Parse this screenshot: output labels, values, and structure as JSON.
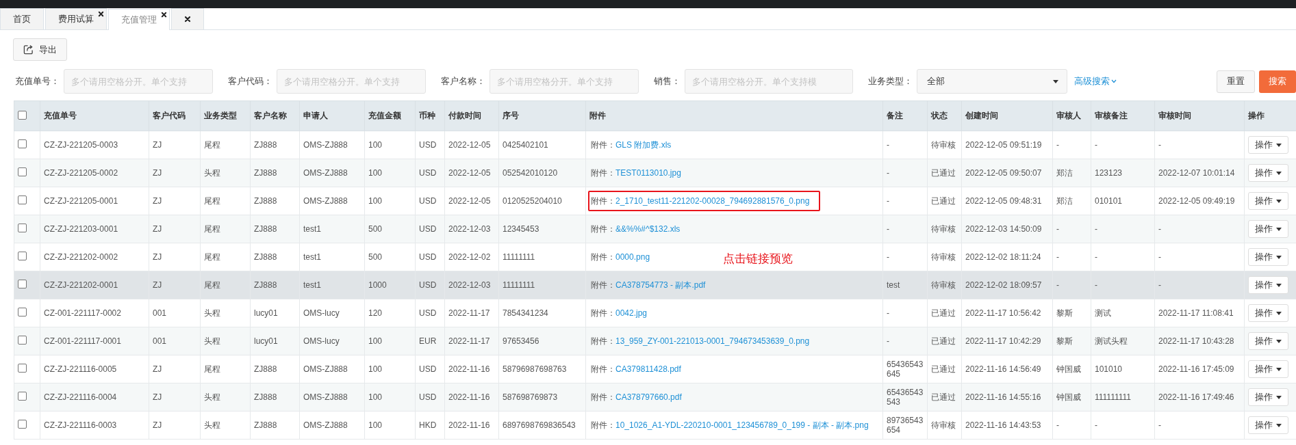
{
  "tabs": [
    {
      "kind": "page",
      "label": "首页",
      "closable": false,
      "selected": false
    },
    {
      "kind": "page",
      "label": "费用试算",
      "closable": true,
      "selected": false
    },
    {
      "kind": "page",
      "label": "充值管理",
      "closable": true,
      "selected": true
    },
    {
      "kind": "close-all",
      "selected": false
    }
  ],
  "toolbar": {
    "export_button": "导出"
  },
  "filters": [
    {
      "kind": "text",
      "label": "充值单号：",
      "placeholder": "多个请用空格分开。单个支持"
    },
    {
      "kind": "text",
      "label": "客户代码：",
      "placeholder": "多个请用空格分开。单个支持"
    },
    {
      "kind": "text",
      "label": "客户名称：",
      "placeholder": "多个请用空格分开。单个支持"
    },
    {
      "kind": "text",
      "label": "销售：",
      "placeholder": "多个请用空格分开。单个支持模"
    },
    {
      "kind": "select",
      "label": "业务类型：",
      "value": "全部"
    }
  ],
  "advanced_search": "高级搜索",
  "buttons": {
    "reset": "重置",
    "search": "搜索"
  },
  "table": {
    "select_all": {
      "checked": false
    },
    "columns": [
      "充值单号",
      "客户代码",
      "业务类型",
      "客户名称",
      "申请人",
      "充值金额",
      "币种",
      "付款时间",
      "序号",
      "附件",
      "备注",
      "状态",
      "创建时间",
      "审核人",
      "审核备注",
      "审核时间",
      "操作"
    ],
    "rows": [
      {
        "checked": false,
        "hovered": false,
        "annotated": false,
        "cells": [
          "CZ-ZJ-221205-0003",
          "ZJ",
          "尾程",
          "ZJ888",
          "OMS-ZJ888",
          "100",
          "USD",
          "2022-12-05",
          "0425402101"
        ],
        "attachment": {
          "label": "附件：",
          "file": "GLS 附加费.xls"
        },
        "tail": [
          "-",
          "待审核",
          "2022-12-05 09:51:19",
          "-",
          "-",
          "-"
        ],
        "action": "操作"
      },
      {
        "checked": false,
        "hovered": false,
        "annotated": false,
        "cells": [
          "CZ-ZJ-221205-0002",
          "ZJ",
          "头程",
          "ZJ888",
          "OMS-ZJ888",
          "100",
          "USD",
          "2022-12-05",
          "052542010120"
        ],
        "attachment": {
          "label": "附件：",
          "file": "TEST0113010.jpg"
        },
        "tail": [
          "-",
          "已通过",
          "2022-12-05 09:50:07",
          "郑洁",
          "123123",
          "2022-12-07 10:01:14"
        ],
        "action": "操作"
      },
      {
        "checked": false,
        "hovered": false,
        "annotated": true,
        "cells": [
          "CZ-ZJ-221205-0001",
          "ZJ",
          "尾程",
          "ZJ888",
          "OMS-ZJ888",
          "100",
          "USD",
          "2022-12-05",
          "0120525204010"
        ],
        "attachment": {
          "label": "附件：",
          "file": "2_1710_test11-221202-00028_794692881576_0.png"
        },
        "tail": [
          "-",
          "已通过",
          "2022-12-05 09:48:31",
          "郑洁",
          "010101",
          "2022-12-05 09:49:19"
        ],
        "action": "操作"
      },
      {
        "checked": false,
        "hovered": false,
        "annotated": false,
        "cells": [
          "CZ-ZJ-221203-0001",
          "ZJ",
          "尾程",
          "ZJ888",
          "test1",
          "500",
          "USD",
          "2022-12-03",
          "12345453"
        ],
        "attachment": {
          "label": "附件：",
          "file": "&&%%#^$132.xls"
        },
        "tail": [
          "-",
          "待审核",
          "2022-12-03 14:50:09",
          "-",
          "-",
          "-"
        ],
        "action": "操作"
      },
      {
        "checked": false,
        "hovered": false,
        "annotated": false,
        "cells": [
          "CZ-ZJ-221202-0002",
          "ZJ",
          "尾程",
          "ZJ888",
          "test1",
          "500",
          "USD",
          "2022-12-02",
          "11111111"
        ],
        "attachment": {
          "label": "附件：",
          "file": "0000.png"
        },
        "tail": [
          "-",
          "待审核",
          "2022-12-02 18:11:24",
          "-",
          "-",
          "-"
        ],
        "action": "操作"
      },
      {
        "checked": false,
        "hovered": true,
        "annotated": false,
        "cells": [
          "CZ-ZJ-221202-0001",
          "ZJ",
          "尾程",
          "ZJ888",
          "test1",
          "1000",
          "USD",
          "2022-12-03",
          "11111111"
        ],
        "attachment": {
          "label": "附件：",
          "file": "CA378754773 - 副本.pdf"
        },
        "tail": [
          "test",
          "待审核",
          "2022-12-02 18:09:57",
          "-",
          "-",
          "-"
        ],
        "action": "操作"
      },
      {
        "checked": false,
        "hovered": false,
        "annotated": false,
        "cells": [
          "CZ-001-221117-0002",
          "001",
          "头程",
          "lucy01",
          "OMS-lucy",
          "120",
          "USD",
          "2022-11-17",
          "7854341234"
        ],
        "attachment": {
          "label": "附件：",
          "file": "0042.jpg"
        },
        "tail": [
          "-",
          "已通过",
          "2022-11-17 10:56:42",
          "黎斯",
          "测试",
          "2022-11-17 11:08:41"
        ],
        "action": "操作"
      },
      {
        "checked": false,
        "hovered": false,
        "annotated": false,
        "cells": [
          "CZ-001-221117-0001",
          "001",
          "头程",
          "lucy01",
          "OMS-lucy",
          "100",
          "EUR",
          "2022-11-17",
          "97653456"
        ],
        "attachment": {
          "label": "附件：",
          "file": "13_959_ZY-001-221013-0001_794673453639_0.png"
        },
        "tail": [
          "-",
          "已通过",
          "2022-11-17 10:42:29",
          "黎斯",
          "测试头程",
          "2022-11-17 10:43:28"
        ],
        "action": "操作"
      },
      {
        "checked": false,
        "hovered": false,
        "annotated": false,
        "cells": [
          "CZ-ZJ-221116-0005",
          "ZJ",
          "尾程",
          "ZJ888",
          "OMS-ZJ888",
          "100",
          "USD",
          "2022-11-16",
          "58796987698763"
        ],
        "attachment": {
          "label": "附件：",
          "file": "CA379811428.pdf"
        },
        "tail": [
          "65436543645",
          "已通过",
          "2022-11-16 14:56:49",
          "钟国威",
          "101010",
          "2022-11-16 17:45:09"
        ],
        "action": "操作"
      },
      {
        "checked": false,
        "hovered": false,
        "annotated": false,
        "cells": [
          "CZ-ZJ-221116-0004",
          "ZJ",
          "头程",
          "ZJ888",
          "OMS-ZJ888",
          "100",
          "USD",
          "2022-11-16",
          "587698769873"
        ],
        "attachment": {
          "label": "附件：",
          "file": "CA378797660.pdf"
        },
        "tail": [
          "65436543543",
          "已通过",
          "2022-11-16 14:55:16",
          "钟国威",
          "111111111",
          "2022-11-16 17:49:46"
        ],
        "action": "操作"
      },
      {
        "checked": false,
        "hovered": false,
        "annotated": false,
        "cells": [
          "CZ-ZJ-221116-0003",
          "ZJ",
          "头程",
          "ZJ888",
          "OMS-ZJ888",
          "100",
          "HKD",
          "2022-11-16",
          "6897698769836543"
        ],
        "attachment": {
          "label": "附件：",
          "file": "10_1026_A1-YDL-220210-0001_123456789_0_199 - 副本 - 副本.png"
        },
        "tail": [
          "89736543654",
          "待审核",
          "2022-11-16 14:43:53",
          "-",
          "-",
          "-"
        ],
        "action": "操作"
      }
    ]
  },
  "annotation": {
    "text": "点击链接预览"
  }
}
